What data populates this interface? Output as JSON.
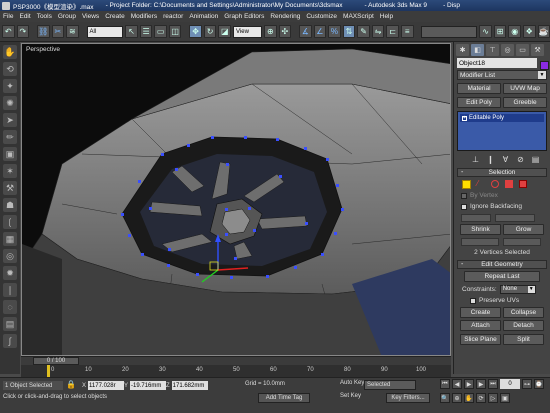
{
  "titlebar": {
    "left": "PSP3000《模型渲染》.max",
    "project": "- Project Folder: C:\\Documents and Settings\\Administrator\\My Documents\\3dsmax",
    "app": "- Autodesk 3ds Max 9",
    "right": "- Disp"
  },
  "menu": [
    "File",
    "Edit",
    "Tools",
    "Group",
    "Views",
    "Create",
    "Modifiers",
    "reactor",
    "Animation",
    "Graph Editors",
    "Rendering",
    "Customize",
    "MAXScript",
    "Help"
  ],
  "toolbar": {
    "selection_filter": "All",
    "ref_coord": "View"
  },
  "viewport": {
    "label": "Perspective"
  },
  "panel": {
    "object_name": "Object18",
    "object_color": "#8a2be2",
    "modifier_list": "Modifier List",
    "buttons": [
      "Material",
      "UVW Map",
      "Edit Poly",
      "Greeble"
    ],
    "stack_item": "Editable Poly",
    "selection": {
      "title": "Selection",
      "by_vertex": "By Vertex",
      "ignore_backfacing": "Ignore Backfacing",
      "shrink": "Shrink",
      "grow": "Grow",
      "status": "2 Vertices Selected"
    },
    "edit_geometry": {
      "title": "Edit Geometry",
      "repeat_last": "Repeat Last",
      "constraints_label": "Constraints:",
      "constraints_value": "None",
      "preserve_uvs": "Preserve UVs",
      "create": "Create",
      "collapse": "Collapse",
      "attach": "Attach",
      "detach": "Detach",
      "slice_plane": "Slice Plane",
      "split": "Split"
    }
  },
  "timeslider": {
    "frame": "0 / 100"
  },
  "timeline": {
    "ticks": [
      "0",
      "10",
      "20",
      "30",
      "40",
      "50",
      "60",
      "70",
      "80",
      "90",
      "100"
    ]
  },
  "statusbar": {
    "selection": "1 Object Selected",
    "prompt": "Click or click-and-drag to select objects",
    "x_label": "X",
    "x": "1177.028r",
    "y_label": "Y",
    "y": "-19.716mm",
    "z_label": "Z",
    "z": "171.682mm",
    "grid": "Grid = 10.0mm",
    "time_tag": "Add Time Tag",
    "auto_key": "Auto Key",
    "set_key": "Set Key",
    "key_mode": "Selected",
    "key_filters": "Key Filters...",
    "frame_field": "0"
  }
}
